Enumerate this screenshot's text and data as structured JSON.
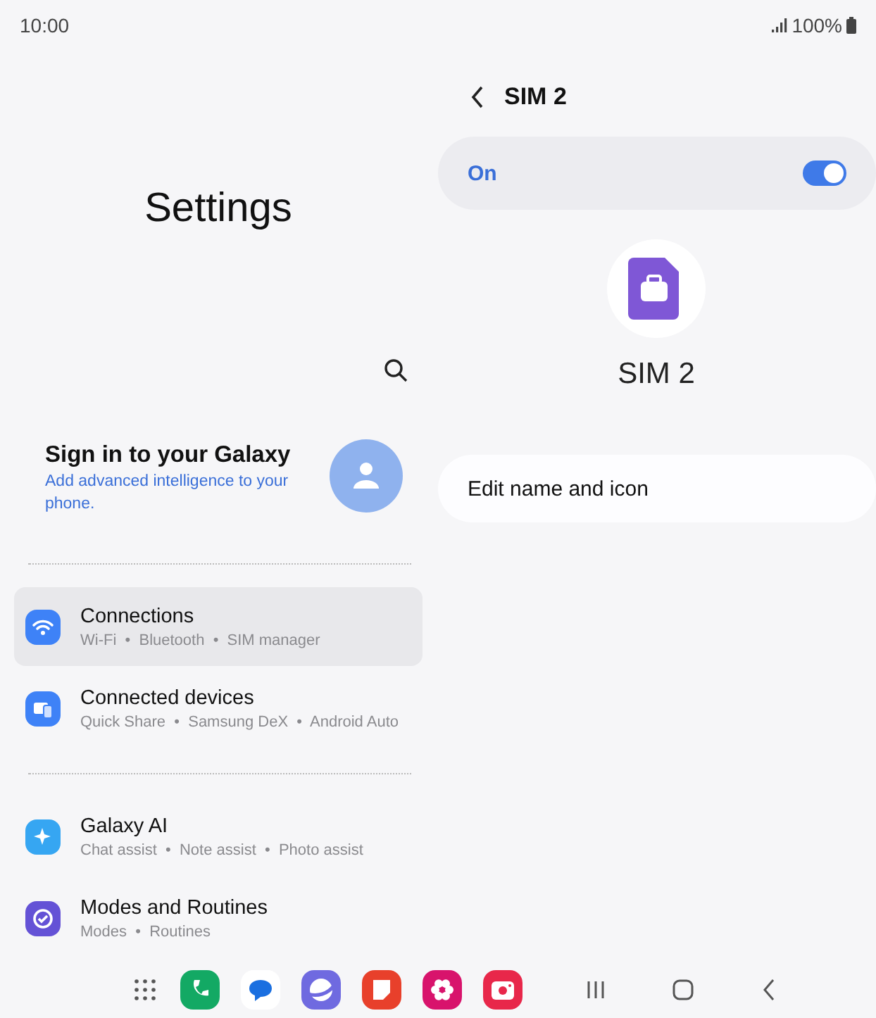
{
  "status_bar": {
    "time": "10:00",
    "battery": "100%"
  },
  "settings": {
    "title": "Settings",
    "account": {
      "title": "Sign in to your Galaxy",
      "subtitle": "Add advanced intelligence to your phone."
    },
    "groups": [
      {
        "items": [
          {
            "title": "Connections",
            "subtitle": "Wi-Fi  •  Bluetooth  •  SIM manager",
            "selected": true
          },
          {
            "title": "Connected devices",
            "subtitle": "Quick Share  •  Samsung DeX  •  Android Auto",
            "selected": false
          }
        ]
      },
      {
        "items": [
          {
            "title": "Galaxy AI",
            "subtitle": "Chat assist  •  Note assist  •  Photo assist",
            "selected": false
          },
          {
            "title": "Modes and Routines",
            "subtitle": "Modes  •  Routines",
            "selected": false
          }
        ]
      }
    ]
  },
  "sim": {
    "title": "SIM 2",
    "toggle": {
      "label": "On",
      "on": true
    },
    "name": "SIM 2",
    "edit_label": "Edit name and icon"
  }
}
